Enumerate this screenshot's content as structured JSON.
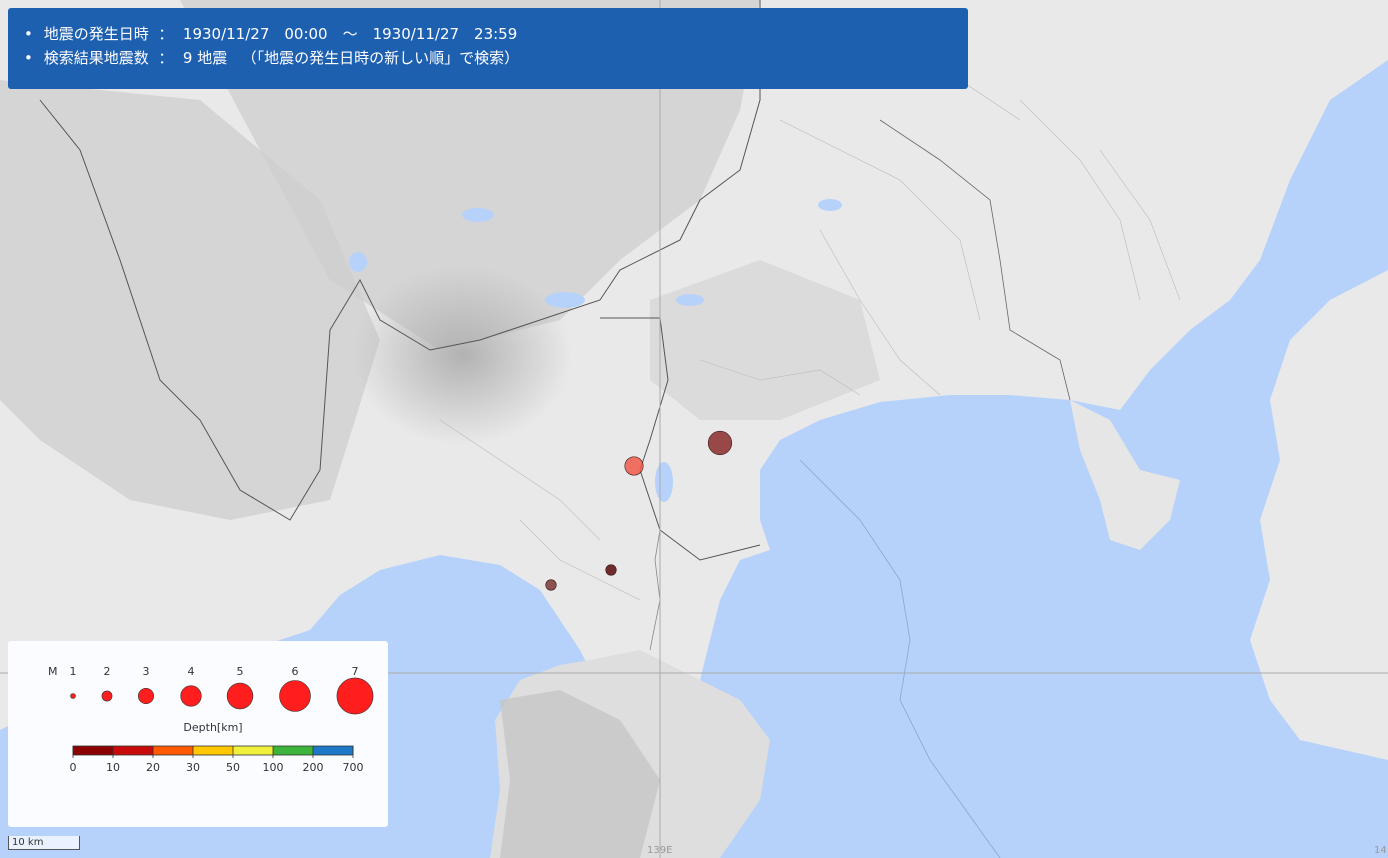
{
  "info": {
    "date_label": "地震の発生日時",
    "date_range": "1930/11/27　00:00　～　1930/11/27　23:59",
    "count_label": "検索結果地震数",
    "count_value": "9 地震",
    "sort_note": "（「地震の発生日時の新しい順」で検索）"
  },
  "legend": {
    "magnitude_label": "M",
    "magnitudes": [
      "1",
      "2",
      "3",
      "4",
      "5",
      "6",
      "7"
    ],
    "depth_label": "Depth[km]",
    "depth_ticks": [
      "0",
      "10",
      "20",
      "30",
      "50",
      "100",
      "200",
      "700"
    ],
    "depth_colors": [
      "#8b0000",
      "#c80a0a",
      "#ff5a00",
      "#ffc800",
      "#f0f03c",
      "#3cb43c",
      "#1e78c8",
      "#141478"
    ],
    "marker_color": "#ff1e1e"
  },
  "scale_label": "10 km",
  "grid_labels": {
    "lon_139": "139E",
    "lon_14": "14"
  },
  "earthquakes": [
    {
      "magnitude": 4,
      "depth_color": "#8b2b2b"
    },
    {
      "magnitude": 3,
      "depth_color": "#f05a4a"
    },
    {
      "magnitude": 1.5,
      "depth_color": "#5a0a0a"
    },
    {
      "magnitude": 1.5,
      "depth_color": "#7a3a32"
    }
  ],
  "colors": {
    "sea": "#b6d2fb",
    "land": "#e9e9e9",
    "mountain": "#c8c8c8",
    "header": "#1e60b0"
  }
}
